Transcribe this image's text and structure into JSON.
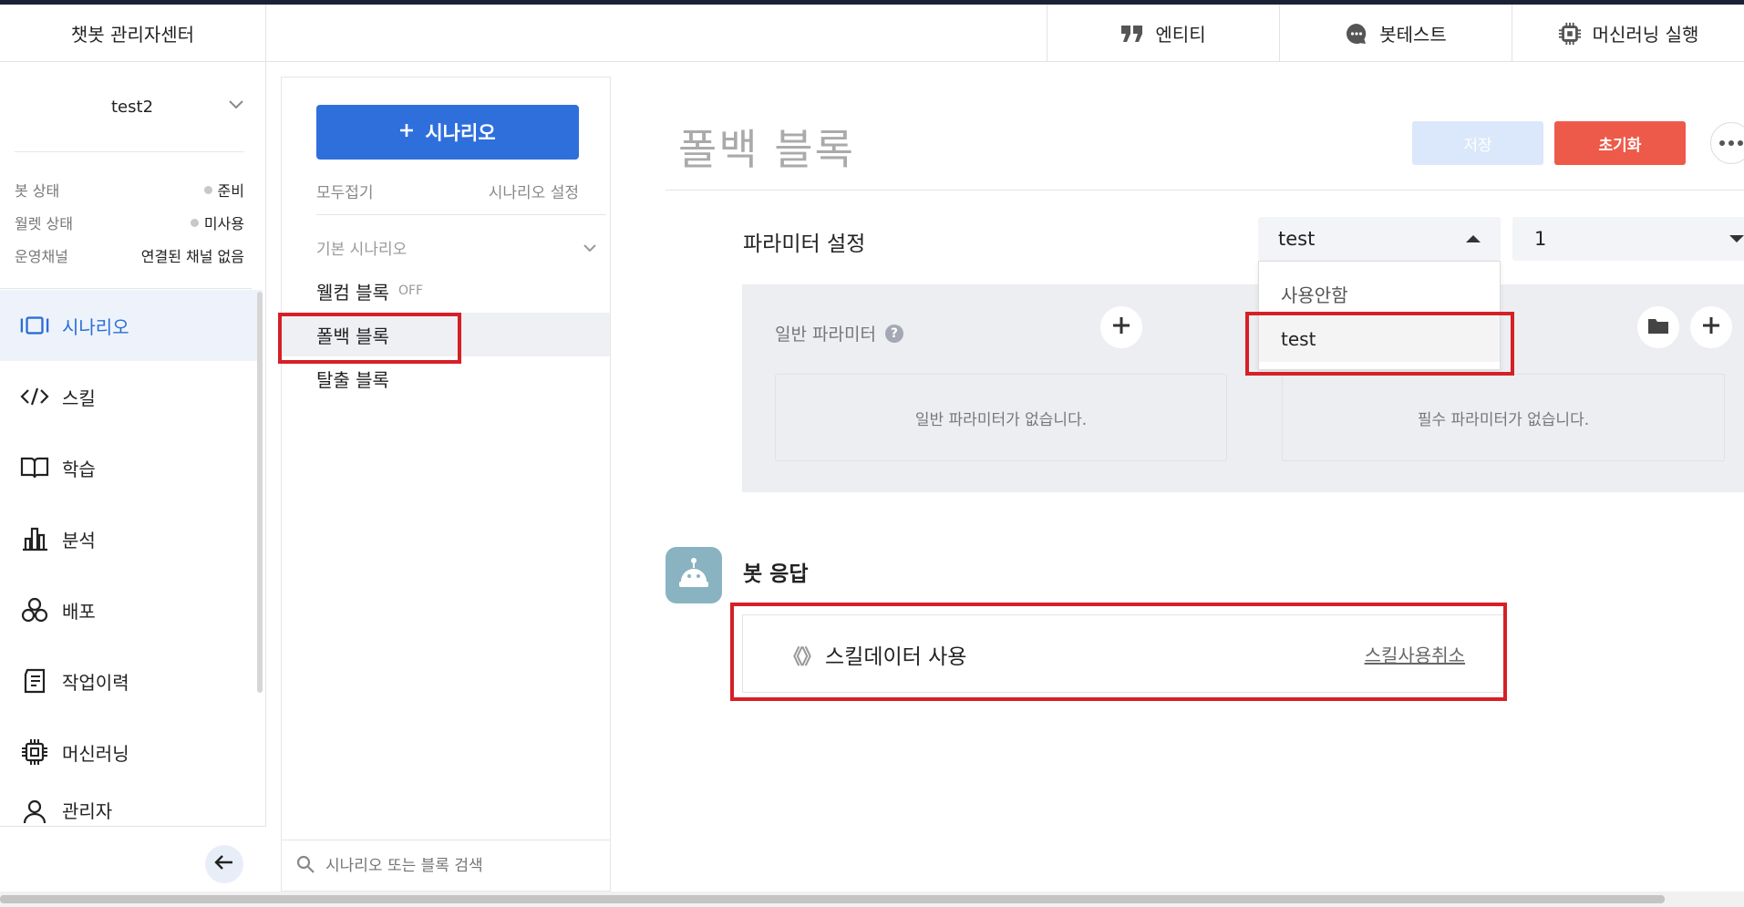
{
  "header": {
    "brand": "챗봇 관리자센터",
    "nav": [
      {
        "label": "엔티티",
        "icon": "quote-icon"
      },
      {
        "label": "봇테스트",
        "icon": "chat-bubble-icon"
      },
      {
        "label": "머신러닝 실행",
        "icon": "chip-icon"
      }
    ]
  },
  "sidebar": {
    "bot_name": "test2",
    "status": [
      {
        "key": "봇 상태",
        "value": "준비"
      },
      {
        "key": "월렛 상태",
        "value": "미사용"
      },
      {
        "key": "운영채널",
        "value": "연결된 채널 없음"
      }
    ],
    "menu": [
      {
        "label": "시나리오",
        "icon": "scenario-icon",
        "active": true
      },
      {
        "label": "스킬",
        "icon": "code-icon"
      },
      {
        "label": "학습",
        "icon": "book-icon"
      },
      {
        "label": "분석",
        "icon": "bar-chart-icon"
      },
      {
        "label": "배포",
        "icon": "deploy-icon"
      },
      {
        "label": "작업이력",
        "icon": "document-icon"
      },
      {
        "label": "머신러닝",
        "icon": "chip-icon"
      },
      {
        "label": "관리자",
        "icon": "user-icon"
      }
    ]
  },
  "scenario_panel": {
    "add_button": "시나리오",
    "collapse_all": "모두접기",
    "settings": "시나리오 설정",
    "group": "기본 시나리오",
    "blocks": [
      {
        "label": "웰컴 블록",
        "tag": "OFF"
      },
      {
        "label": "폴백 블록",
        "tag": ""
      },
      {
        "label": "탈출 블록",
        "tag": ""
      }
    ],
    "search_placeholder": "시나리오 또는 블록 검색"
  },
  "main": {
    "title": "폴백 블록",
    "save": "저장",
    "reset": "초기화",
    "param_label": "파라미터 설정",
    "select1_value": "test",
    "select2_value": "1",
    "dropdown_options": [
      "사용안함",
      "test"
    ],
    "general_param": "일반 파라미터",
    "help": "?",
    "general_empty": "일반 파라미터가 없습니다.",
    "required_empty": "필수 파라미터가 없습니다.",
    "bot_response": "봇 응답",
    "skill_text": "스킬데이터 사용",
    "skill_cancel": "스킬사용취소",
    "skill_icon_glyph": "《》"
  },
  "colors": {
    "accent": "#2f6fdc",
    "reset": "#ee5a4a",
    "highlight": "#d61f26"
  }
}
